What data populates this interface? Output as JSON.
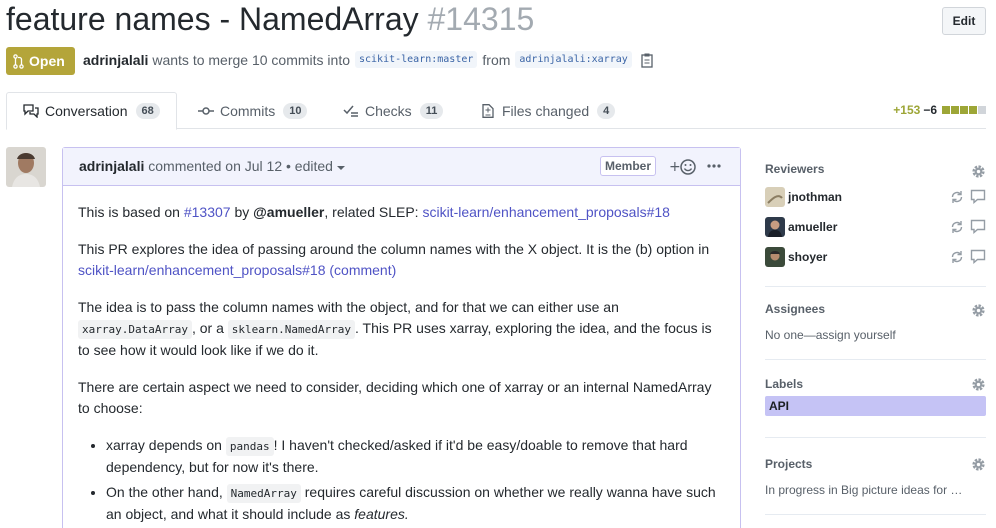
{
  "pr": {
    "title": "feature names - NamedArray",
    "number": "#14315",
    "edit_label": "Edit",
    "state": "Open",
    "author": "adrinjalali",
    "merge_text": "wants to merge 10 commits into",
    "base_branch": "scikit-learn:master",
    "from_text": "from",
    "head_branch": "adrinjalali:xarray"
  },
  "tabs": [
    {
      "label": "Conversation",
      "count": "68"
    },
    {
      "label": "Commits",
      "count": "10"
    },
    {
      "label": "Checks",
      "count": "11"
    },
    {
      "label": "Files changed",
      "count": "4"
    }
  ],
  "diffstat": {
    "additions": "+153",
    "deletions": "−6"
  },
  "comment": {
    "author": "adrinjalali",
    "meta": "commented on Jul 12 • edited",
    "role_badge": "Member",
    "p1_a": "This is based on ",
    "p1_link1": "#13307",
    "p1_b": " by ",
    "p1_user": "@amueller",
    "p1_c": ", related SLEP: ",
    "p1_link2": "scikit-learn/enhancement_proposals#18",
    "p2_a": "This PR explores the idea of passing around the column names with the X object. It is the (b) option in ",
    "p2_link": "scikit-learn/enhancement_proposals#18 (comment)",
    "p3_a": "The idea is to pass the column names with the object, and for that we can either use an ",
    "p3_code1": "xarray.DataArray",
    "p3_b": ", or a ",
    "p3_code2": "sklearn.NamedArray",
    "p3_c": ". This PR uses xarray, exploring the idea, and the focus is to see how it would look like if we do it.",
    "p4": "There are certain aspect we need to consider, deciding which one of xarray or an internal NamedArray to choose:",
    "li1_a": "xarray depends on ",
    "li1_code": "pandas",
    "li1_b": "! I haven't checked/asked if it'd be easy/doable to remove that hard dependency, but for now it's there.",
    "li2_a": "On the other hand, ",
    "li2_code": "NamedArray",
    "li2_b": " requires careful discussion on whether we really wanna have such an object, and what it should include as ",
    "li2_em": "features."
  },
  "sidebar": {
    "reviewers_title": "Reviewers",
    "reviewers": [
      "jnothman",
      "amueller",
      "shoyer"
    ],
    "assignees_title": "Assignees",
    "assignees_text": "No one—assign yourself",
    "labels_title": "Labels",
    "label_api": "API",
    "projects_title": "Projects",
    "projects_text": "In progress in Big picture ideas for …"
  },
  "colors": {
    "open_state": "#b4a53a",
    "link": "#4f53c5",
    "label_api": "#c5c3f5",
    "comment_border": "#c7c1f0"
  },
  "icons": [
    "git-pull-request-icon",
    "clipboard-icon",
    "comment-discussion-icon",
    "git-commit-icon",
    "checklist-icon",
    "file-diff-icon",
    "smiley-icon",
    "kebab-icon",
    "gear-icon",
    "sync-icon",
    "comment-icon"
  ]
}
